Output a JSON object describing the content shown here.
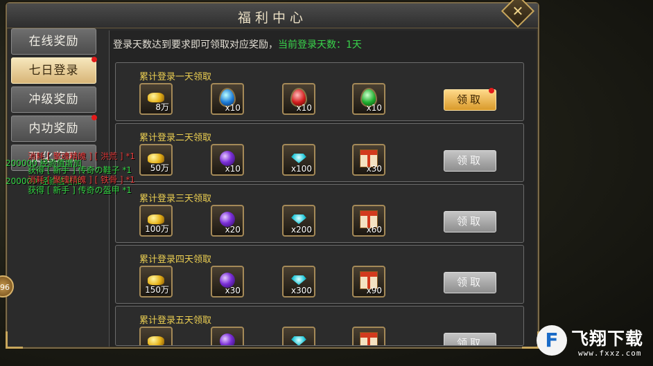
{
  "window": {
    "title": "福利中心",
    "close_glyph": "✕"
  },
  "sidebar": {
    "items": [
      {
        "label": "在线奖励",
        "active": false,
        "red_dot": false
      },
      {
        "label": "七日登录",
        "active": true,
        "red_dot": true
      },
      {
        "label": "冲级奖励",
        "active": false,
        "red_dot": false
      },
      {
        "label": "内功奖励",
        "active": false,
        "red_dot": true
      },
      {
        "label": "强化奖励",
        "active": false,
        "red_dot": false
      }
    ]
  },
  "info": {
    "text": "登录天数达到要求即可领取对应奖励，",
    "highlight": "当前登录天数：1天"
  },
  "rewards": [
    {
      "title": "累计登录一天领取",
      "button": "领取",
      "button_state": "active",
      "red_dot": true,
      "items": [
        {
          "icon": "gold-ingot-icon",
          "count": "8万"
        },
        {
          "icon": "blue-gem-icon",
          "count": "x10"
        },
        {
          "icon": "red-gem-icon",
          "count": "x10"
        },
        {
          "icon": "green-gem-icon",
          "count": "x10"
        }
      ]
    },
    {
      "title": "累计登录二天领取",
      "button": "领取",
      "button_state": "disabled",
      "red_dot": false,
      "items": [
        {
          "icon": "gold-ingot-icon",
          "count": "50万"
        },
        {
          "icon": "purple-orb-icon",
          "count": "x10"
        },
        {
          "icon": "diamond-icon",
          "count": "x100"
        },
        {
          "icon": "gift-box-icon",
          "count": "x30"
        }
      ]
    },
    {
      "title": "累计登录三天领取",
      "button": "领取",
      "button_state": "disabled",
      "red_dot": false,
      "items": [
        {
          "icon": "gold-ingot-icon",
          "count": "100万"
        },
        {
          "icon": "purple-orb-icon",
          "count": "x20"
        },
        {
          "icon": "diamond-icon",
          "count": "x200"
        },
        {
          "icon": "gift-box-icon",
          "count": "x60"
        }
      ]
    },
    {
      "title": "累计登录四天领取",
      "button": "领取",
      "button_state": "disabled",
      "red_dot": false,
      "items": [
        {
          "icon": "gold-ingot-icon",
          "count": "150万"
        },
        {
          "icon": "purple-orb-icon",
          "count": "x30"
        },
        {
          "icon": "diamond-icon",
          "count": "x300"
        },
        {
          "icon": "gift-box-icon",
          "count": "x90"
        }
      ]
    },
    {
      "title": "累计登录五天领取",
      "button": "领取",
      "button_state": "disabled",
      "red_dot": false,
      "items": [
        {
          "icon": "gold-ingot-icon",
          "count": ""
        },
        {
          "icon": "purple-orb-icon",
          "count": ""
        },
        {
          "icon": "diamond-icon",
          "count": ""
        },
        {
          "icon": "gift-box-icon",
          "count": ""
        }
      ]
    }
  ],
  "chat_log": [
    {
      "text": "消耗 [ 聚魂精魄 ] [ 洪荒 ] *1",
      "color": "red"
    },
    {
      "text": "200000 经验值增加",
      "color": "green"
    },
    {
      "text": "获得 [ 新手 ] 传奇の鞋子 *1",
      "color": "green"
    },
    {
      "text": "200000 经验值增加",
      "color": "green"
    },
    {
      "text": "消耗 [ 聚魂精魄 ] [ 铁骨 ] *1",
      "color": "red"
    },
    {
      "text": "获得 [ 新手 ] 传奇の盔甲 *1",
      "color": "green"
    }
  ],
  "avatar": {
    "level": "96"
  },
  "watermark": {
    "name": "飞翔下载",
    "url": "www.fxxz.com",
    "logo_glyph": "F"
  },
  "colors": {
    "accent_gold": "#c9a75c",
    "title_yellow": "#eccf52",
    "highlight_green": "#39d44b",
    "badge_red": "#e31b1b"
  }
}
